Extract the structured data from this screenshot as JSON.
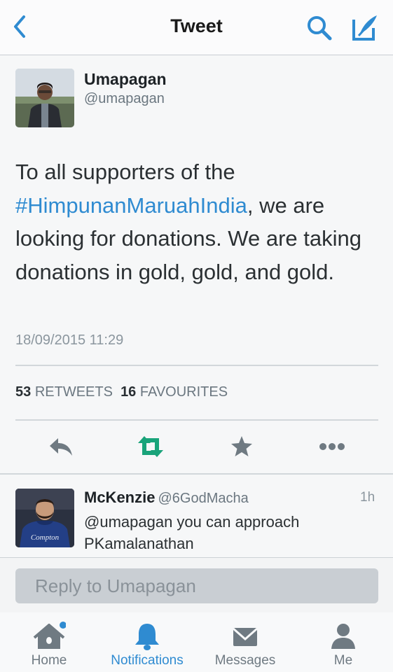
{
  "nav": {
    "title": "Tweet",
    "back_icon": "chevron-left-icon",
    "search_icon": "search-icon",
    "compose_icon": "compose-icon"
  },
  "author": {
    "name": "Umapagan",
    "handle": "@umapagan"
  },
  "tweet": {
    "text_before": "To all supporters of the ",
    "hashtag": "#HimpunanMaruahIndia",
    "text_after": ", we are looking for donations. We are taking donations in gold, gold, and gold.",
    "timestamp": "18/09/2015 11:29"
  },
  "stats": {
    "retweets_count": "53",
    "retweets_label": "RETWEETS",
    "favourites_count": "16",
    "favourites_label": "FAVOURITES"
  },
  "actions": [
    "reply-icon",
    "retweet-icon",
    "favourite-icon",
    "more-icon"
  ],
  "reply_tweet": {
    "name": "McKenzie",
    "handle": "@6GodMacha",
    "time": "1h",
    "text": "@umapagan you can approach PKamalanathan",
    "avatar_text": "Compton"
  },
  "reply_box": {
    "placeholder": "Reply to Umapagan"
  },
  "tabs": [
    {
      "label": "Home",
      "icon": "home-icon"
    },
    {
      "label": "Notifications",
      "icon": "bell-icon",
      "active": true
    },
    {
      "label": "Messages",
      "icon": "envelope-icon"
    },
    {
      "label": "Me",
      "icon": "person-icon"
    }
  ],
  "colors": {
    "accent": "#2f8bd1",
    "retweet_green": "#19a37a",
    "icon_gray": "#6f7a82"
  }
}
